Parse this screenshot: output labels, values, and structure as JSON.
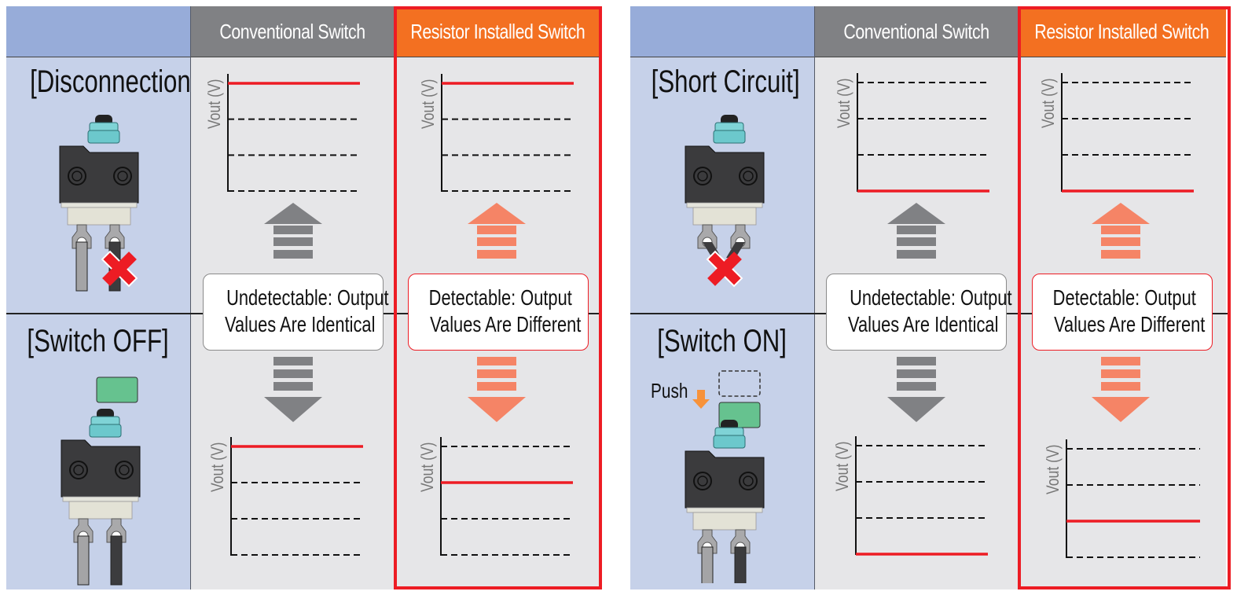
{
  "colors": {
    "label_col_bg": "#c6d1e9",
    "label_header_bg": "#97acd9",
    "conventional_header_bg": "#808184",
    "resistor_header_bg": "#f37021",
    "cell_bg": "#e6e6e8",
    "highlight_frame": "#ed1c24",
    "signal_line": "#ed1c24",
    "arrow_grey": "#808184",
    "arrow_orange": "#f58466",
    "button_green": "#66c28f",
    "push_arrow": "#f7923a"
  },
  "panels": [
    {
      "headers": {
        "conventional": "Conventional Switch",
        "resistor": "Resistor Installed Switch"
      },
      "top_case": {
        "title": "[Disconnection]",
        "illustration": "switch-with-broken-lead"
      },
      "bottom_case": {
        "title": "[Switch OFF]",
        "illustration": "switch-with-button-released"
      },
      "conventional_callout": [
        "Undetectable: Output",
        "Values Are Identical"
      ],
      "resistor_callout": [
        "Detectable: Output",
        "Values Are Different"
      ]
    },
    {
      "headers": {
        "conventional": "Conventional Switch",
        "resistor": "Resistor Installed Switch"
      },
      "top_case": {
        "title": "[Short Circuit]",
        "illustration": "switch-with-shorted-leads"
      },
      "bottom_case": {
        "title": "[Switch ON]",
        "illustration": "switch-with-button-pressed",
        "push_label": "Push"
      },
      "conventional_callout": [
        "Undetectable: Output",
        "Values Are Identical"
      ],
      "resistor_callout": [
        "Detectable: Output",
        "Values Are Different"
      ]
    }
  ],
  "chart_data": [
    {
      "type": "line",
      "panel": "left",
      "case": "Disconnection",
      "switch": "Conventional Switch",
      "ylabel": "Vout (V)",
      "levels": [
        0,
        1,
        2,
        3
      ],
      "signal_level": 3
    },
    {
      "type": "line",
      "panel": "left",
      "case": "Disconnection",
      "switch": "Resistor Installed Switch",
      "ylabel": "Vout (V)",
      "levels": [
        0,
        1,
        2,
        3
      ],
      "signal_level": 3
    },
    {
      "type": "line",
      "panel": "left",
      "case": "Switch OFF",
      "switch": "Conventional Switch",
      "ylabel": "Vout (V)",
      "levels": [
        0,
        1,
        2,
        3
      ],
      "signal_level": 3
    },
    {
      "type": "line",
      "panel": "left",
      "case": "Switch OFF",
      "switch": "Resistor Installed Switch",
      "ylabel": "Vout (V)",
      "levels": [
        0,
        1,
        2,
        3
      ],
      "signal_level": 2
    },
    {
      "type": "line",
      "panel": "right",
      "case": "Short Circuit",
      "switch": "Conventional Switch",
      "ylabel": "Vout (V)",
      "levels": [
        0,
        1,
        2,
        3
      ],
      "signal_level": 0
    },
    {
      "type": "line",
      "panel": "right",
      "case": "Short Circuit",
      "switch": "Resistor Installed Switch",
      "ylabel": "Vout (V)",
      "levels": [
        0,
        1,
        2,
        3
      ],
      "signal_level": 0
    },
    {
      "type": "line",
      "panel": "right",
      "case": "Switch ON",
      "switch": "Conventional Switch",
      "ylabel": "Vout (V)",
      "levels": [
        0,
        1,
        2,
        3
      ],
      "signal_level": 0
    },
    {
      "type": "line",
      "panel": "right",
      "case": "Switch ON",
      "switch": "Resistor Installed Switch",
      "ylabel": "Vout (V)",
      "levels": [
        0,
        1,
        2,
        3
      ],
      "signal_level": 1
    }
  ]
}
